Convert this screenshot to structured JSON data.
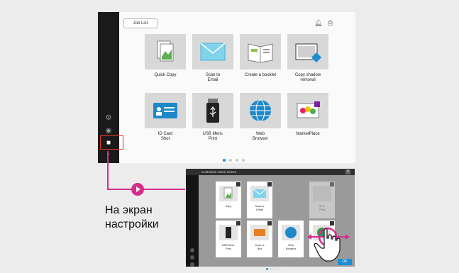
{
  "header": {
    "job_list_label": "Job List"
  },
  "sidebar": {
    "icons": [
      "gear-icon",
      "globe-icon",
      "cube-icon",
      "chevron-right-icon"
    ]
  },
  "tiles": [
    {
      "label": "Quick Copy",
      "icon": "quick-copy-icon"
    },
    {
      "label": "Scan to\nEmail",
      "icon": "email-icon"
    },
    {
      "label": "Create a booklet",
      "icon": "booklet-icon"
    },
    {
      "label": "Copy shadow\nremoval",
      "icon": "copy-shadow-icon"
    },
    {
      "label": "ID Card\nShot",
      "icon": "id-card-icon"
    },
    {
      "label": "USB Mem.\nPrint",
      "icon": "usb-icon"
    },
    {
      "label": "Web\nBrowser",
      "icon": "web-browser-icon"
    },
    {
      "label": "MarketPlace",
      "icon": "marketplace-icon"
    }
  ],
  "pagination": {
    "pages": 4,
    "current": 1
  },
  "caption": {
    "line1": "На экран",
    "line2": "настройки"
  },
  "customize": {
    "title": "Customize Home screen",
    "ok_label": "OK",
    "tiles": [
      {
        "label": "Copy"
      },
      {
        "label": "Scan to\nEmail"
      },
      {
        "label": ""
      },
      {
        "label": "ID Is\nPrint"
      },
      {
        "label": "USB Mem.\nPrint"
      },
      {
        "label": "Scan to\nBox"
      },
      {
        "label": "Web\nBrowser"
      },
      {
        "label": ""
      }
    ]
  },
  "colors": {
    "accent": "#d62c8c",
    "highlight": "#e8352c",
    "active_dot": "#1c8fd4"
  }
}
